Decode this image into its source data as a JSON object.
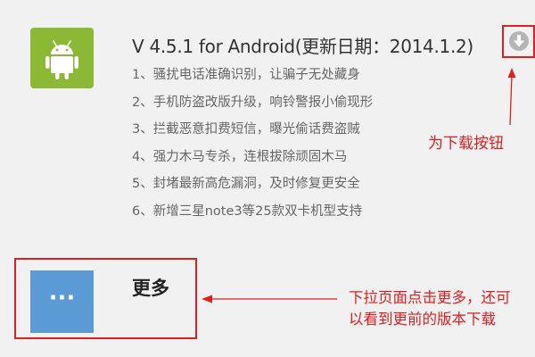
{
  "release": {
    "title": "V 4.5.1 for Android(更新日期：2014.1.2)",
    "features": [
      "1、骚扰电话准确识别，让骗子无处藏身",
      "2、手机防盗改版升级，响铃警报小偷现形",
      "3、拦截恶意扣费短信，曝光偷话费盗贼",
      "4、强力木马专杀，连根拔除顽固木马",
      "5、封堵最新高危漏洞，及时修复更安全",
      "6、新增三星note3等25款双卡机型支持"
    ],
    "icon": "android-icon",
    "icon_color": "#8bb835"
  },
  "download": {
    "icon": "download-arrow-icon",
    "caption": "为下载按钮"
  },
  "more": {
    "icon_glyph": "···",
    "icon_color": "#5b9bd5",
    "label": "更多",
    "caption_line1": "下拉页面点击更多，还可",
    "caption_line2": "以看到更前的版本下载"
  },
  "annotation_color": "#e02020"
}
